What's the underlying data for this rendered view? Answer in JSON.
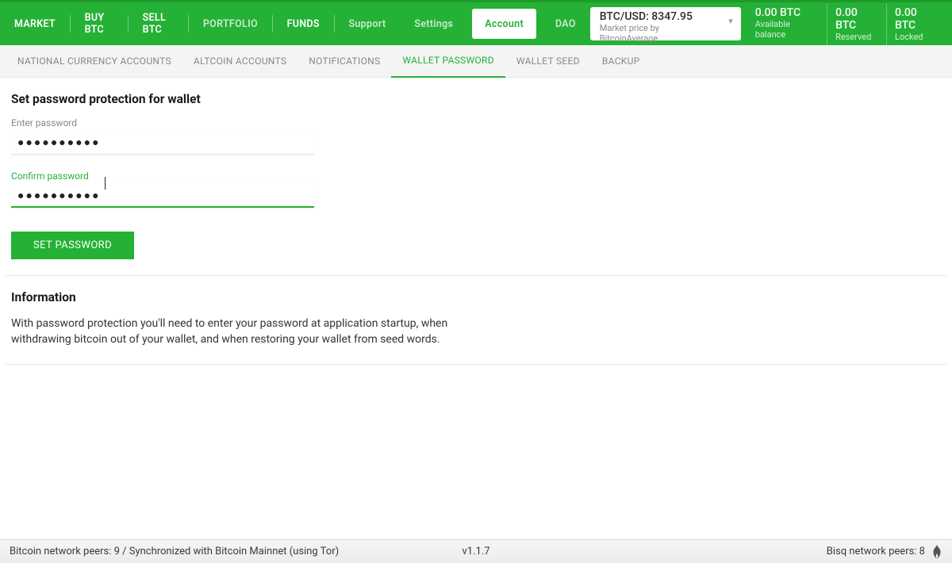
{
  "nav": {
    "market": "MARKET",
    "buy": "BUY BTC",
    "sell": "SELL BTC",
    "portfolio": "PORTFOLIO",
    "funds": "FUNDS",
    "support": "Support",
    "settings": "Settings",
    "account": "Account",
    "dao": "DAO"
  },
  "price": {
    "line1": "BTC/USD: 8347.95",
    "line2": "Market price by BitcoinAverage"
  },
  "balances": {
    "available": {
      "amount": "0.00 BTC",
      "label": "Available balance"
    },
    "reserved": {
      "amount": "0.00 BTC",
      "label": "Reserved"
    },
    "locked": {
      "amount": "0.00 BTC",
      "label": "Locked"
    }
  },
  "subnav": {
    "national": "NATIONAL CURRENCY ACCOUNTS",
    "altcoin": "ALTCOIN ACCOUNTS",
    "notifications": "NOTIFICATIONS",
    "wallet_password": "WALLET PASSWORD",
    "wallet_seed": "WALLET SEED",
    "backup": "BACKUP"
  },
  "form": {
    "title": "Set password protection for wallet",
    "enter_label": "Enter password",
    "enter_value": "●●●●●●●●●●",
    "confirm_label": "Confirm password",
    "confirm_value": "●●●●●●●●●●",
    "button": "SET PASSWORD"
  },
  "info": {
    "title": "Information",
    "text": "With password protection you'll need to enter your password at application startup, when withdrawing bitcoin out of your wallet, and when restoring your wallet from seed words."
  },
  "status": {
    "left": "Bitcoin network peers: 9 / Synchronized with Bitcoin Mainnet (using Tor)",
    "version": "v1.1.7",
    "right": "Bisq network peers: 8"
  }
}
